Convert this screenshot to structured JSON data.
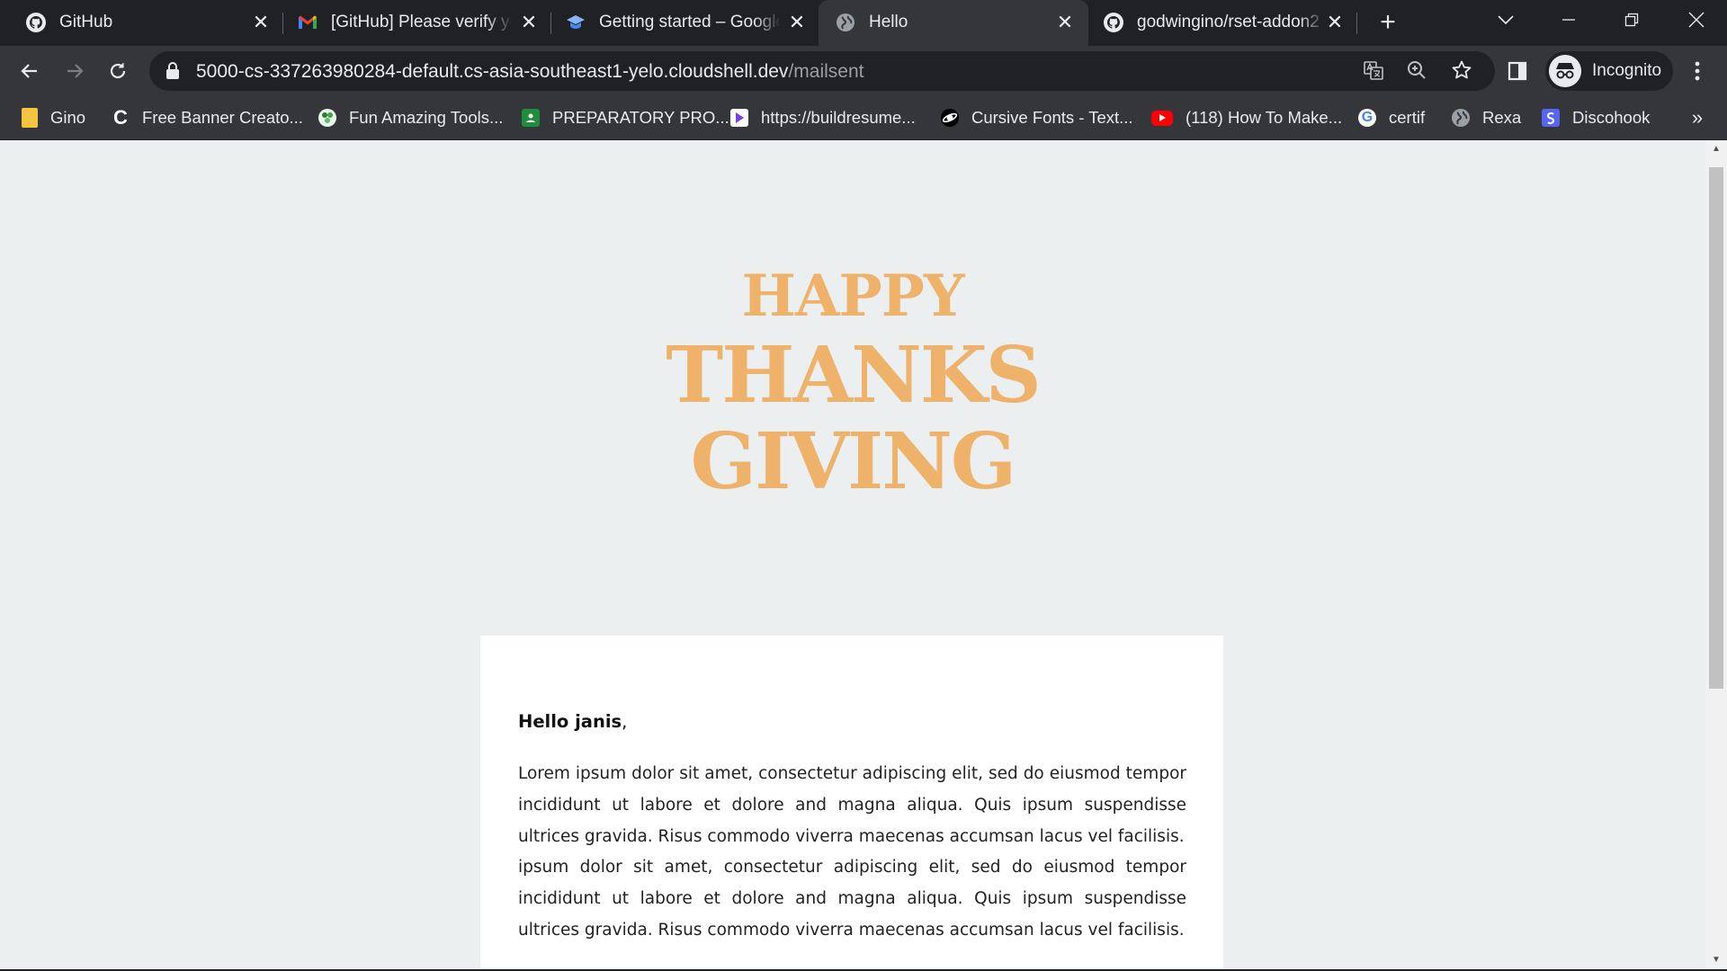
{
  "browser": {
    "tabs": [
      {
        "title": "GitHub",
        "icon": "github-icon",
        "active": false
      },
      {
        "title": "[GitHub] Please verify yo",
        "icon": "gmail-icon",
        "active": false
      },
      {
        "title": "Getting started – Google",
        "icon": "cloud-skills-icon",
        "active": false
      },
      {
        "title": "Hello",
        "icon": "globe-icon",
        "active": true
      },
      {
        "title": "godwingino/rset-addon2",
        "icon": "github-icon",
        "active": false
      }
    ],
    "new_tab_label": "+",
    "url_host": "5000-cs-337263980284-default.cs-asia-southeast1-yelo.cloudshell.dev",
    "url_path": "/mailsent",
    "profile_label": "Incognito",
    "bookmarks": [
      {
        "label": "Gino",
        "icon": "folder-icon",
        "color": "#f5c542"
      },
      {
        "label": "Free Banner Creato...",
        "icon": "c-logo-icon",
        "color": "#202124"
      },
      {
        "label": "Fun Amazing Tools...",
        "icon": "tools-icon",
        "color": "#2e7d32"
      },
      {
        "label": "PREPARATORY PRO...",
        "icon": "classroom-icon",
        "color": "#1e8e3e"
      },
      {
        "label": "https://buildresume...",
        "icon": "play-icon",
        "color": "#7b3fe4"
      },
      {
        "label": "Cursive Fonts - Text...",
        "icon": "planet-icon",
        "color": "#e8eaed"
      },
      {
        "label": "(118) How To Make...",
        "icon": "youtube-icon",
        "color": "#ff0000"
      },
      {
        "label": "certif",
        "icon": "google-icon",
        "color": "#e8eaed"
      },
      {
        "label": "Rexa",
        "icon": "globe-icon",
        "color": "#9aa0a6"
      },
      {
        "label": "Discohook",
        "icon": "discohook-icon",
        "color": "#5865f2"
      }
    ]
  },
  "page": {
    "hero": {
      "line1": "HAPPY",
      "line2": "THANKS",
      "line3": "GIVING"
    },
    "accent_color": "#eeb26b",
    "greeting_name": "Hello janis",
    "greeting_punct": ",",
    "paragraph1": "Lorem ipsum dolor sit amet, consectetur adipiscing elit, sed do eiusmod tempor incididunt ut labore et dolore and magna aliqua. Quis ipsum suspendisse ultrices gravida. Risus commodo viverra maecenas accumsan lacus vel facilisis.",
    "paragraph2": "ipsum dolor sit amet, consectetur adipiscing elit, sed do eiusmod tempor incididunt ut labore et dolore and magna aliqua. Quis ipsum suspendisse ultrices gravida. Risus commodo viverra maecenas accumsan lacus vel facilisis."
  }
}
